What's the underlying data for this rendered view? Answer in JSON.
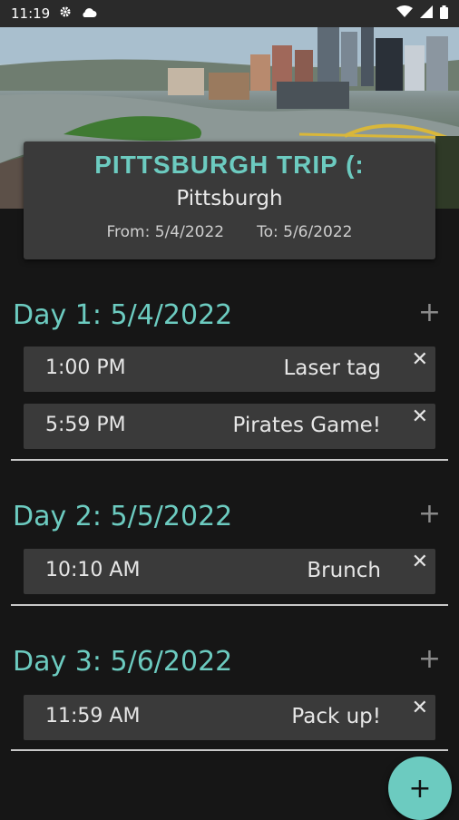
{
  "status_bar": {
    "time": "11:19"
  },
  "trip": {
    "title": "PITTSBURGH TRIP (:",
    "city": "Pittsburgh",
    "from": "From: 5/4/2022",
    "to": "To: 5/6/2022"
  },
  "days": [
    {
      "header": "Day 1: 5/4/2022",
      "items": [
        {
          "time": "1:00 PM",
          "name": "Laser tag"
        },
        {
          "time": "5:59 PM",
          "name": "Pirates Game!"
        }
      ]
    },
    {
      "header": "Day 2: 5/5/2022",
      "items": [
        {
          "time": "10:10 AM",
          "name": "Brunch"
        }
      ]
    },
    {
      "header": "Day 3: 5/6/2022",
      "items": [
        {
          "time": "11:59 AM",
          "name": "Pack up!"
        }
      ]
    }
  ],
  "icons": {
    "add": "+",
    "remove": "✕",
    "fab": "+"
  },
  "colors": {
    "accent": "#6ccbc0",
    "background": "#161616",
    "card": "#3a3a3a"
  }
}
